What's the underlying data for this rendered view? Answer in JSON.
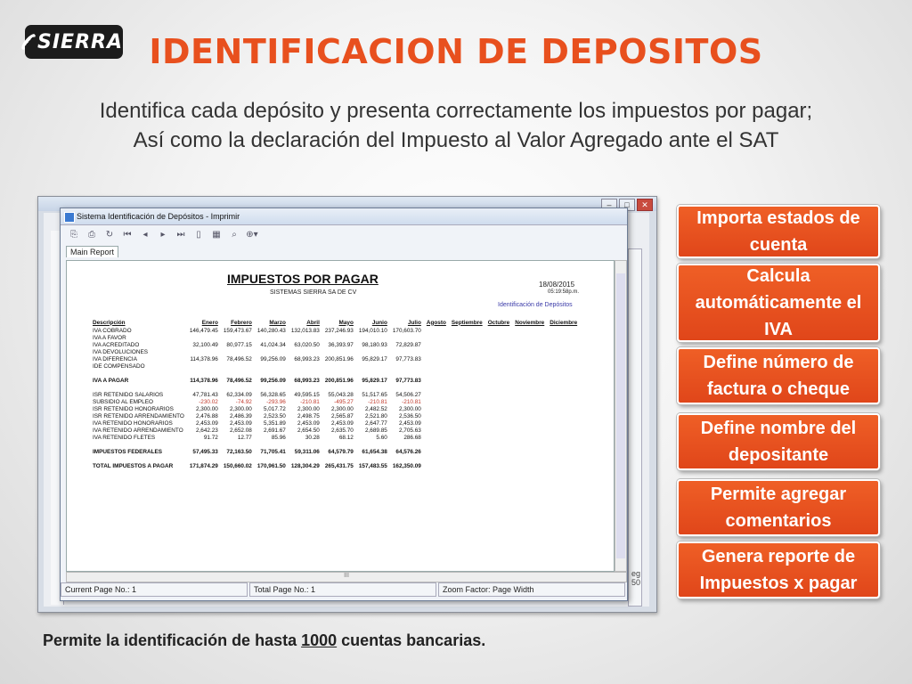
{
  "logo_text": "SIERRA",
  "title": "IDENTIFICACION DE DEPOSITOS",
  "subtitle_line1": "Identifica cada depósito y presenta correctamente los impuestos por pagar;",
  "subtitle_line2": "Así como la declaración del Impuesto al Valor Agregado ante el SAT",
  "features": [
    "Importa estados de cuenta",
    "Calcula automáticamente el IVA",
    "Define número de factura o cheque",
    "Define nombre del depositante",
    "Permite agregar comentarios",
    "Genera reporte de Impuestos x pagar"
  ],
  "footnote": {
    "before": "Permite la identificación de hasta ",
    "number": "1000",
    "after": " cuentas bancarias."
  },
  "window": {
    "title": "Sistema Identificación de Depósitos - Imprimir",
    "tab": "Main Report",
    "status_current": "Current Page No.: 1",
    "status_total": "Total Page No.: 1",
    "status_zoom": "Zoom Factor: Page Width",
    "bg_bottom_1": "eg",
    "bg_bottom_2": "50"
  },
  "report": {
    "title": "IMPUESTOS POR PAGAR",
    "company": "SISTEMAS SIERRA SA DE CV",
    "date": "18/08/2015",
    "time": "05:19:58p.m.",
    "link": "Identificación de Depósitos",
    "columns": [
      "Descripción",
      "Enero",
      "Febrero",
      "Marzo",
      "Abril",
      "Mayo",
      "Junio",
      "Julio",
      "Agosto",
      "Septiembre",
      "Octubre",
      "Noviembre",
      "Diciembre"
    ],
    "rows": [
      {
        "type": "row",
        "cells": [
          "IVA COBRADO",
          "146,479.45",
          "159,473.67",
          "140,280.43",
          "132,013.83",
          "237,246.93",
          "194,010.10",
          "170,603.70",
          "",
          "",
          "",
          "",
          ""
        ]
      },
      {
        "type": "row",
        "cells": [
          "IVA A FAVOR",
          "",
          "",
          "",
          "",
          "",
          "",
          "",
          "",
          "",
          "",
          "",
          ""
        ]
      },
      {
        "type": "row",
        "cells": [
          "IVA ACREDITADO",
          "32,100.49",
          "80,977.15",
          "41,024.34",
          "63,020.50",
          "36,393.97",
          "98,180.93",
          "72,829.87",
          "",
          "",
          "",
          "",
          ""
        ]
      },
      {
        "type": "row",
        "cells": [
          "IVA DEVOLUCIONES",
          "",
          "",
          "",
          "",
          "",
          "",
          "",
          "",
          "",
          "",
          "",
          ""
        ]
      },
      {
        "type": "row",
        "cells": [
          "IVA DIFERENCIA",
          "114,378.96",
          "78,496.52",
          "99,256.09",
          "68,993.23",
          "200,851.96",
          "95,829.17",
          "97,773.83",
          "",
          "",
          "",
          "",
          ""
        ]
      },
      {
        "type": "row",
        "cells": [
          "IDE COMPENSADO",
          "",
          "",
          "",
          "",
          "",
          "",
          "",
          "",
          "",
          "",
          "",
          ""
        ]
      },
      {
        "type": "gap",
        "cells": [
          "",
          "",
          "",
          "",
          "",
          "",
          "",
          "",
          "",
          "",
          "",
          "",
          ""
        ]
      },
      {
        "type": "bold",
        "cells": [
          "IVA A PAGAR",
          "114,378.96",
          "78,496.52",
          "99,256.09",
          "68,993.23",
          "200,851.96",
          "95,829.17",
          "97,773.83",
          "",
          "",
          "",
          "",
          ""
        ]
      },
      {
        "type": "gap",
        "cells": [
          "",
          "",
          "",
          "",
          "",
          "",
          "",
          "",
          "",
          "",
          "",
          "",
          ""
        ]
      },
      {
        "type": "row",
        "cells": [
          "ISR RETENIDO SALARIOS",
          "47,781.43",
          "62,334.09",
          "56,328.65",
          "49,595.15",
          "55,043.28",
          "51,517.65",
          "54,506.27",
          "",
          "",
          "",
          "",
          ""
        ]
      },
      {
        "type": "neg",
        "cells": [
          "SUBSIDIO AL EMPLEO",
          "-230.02",
          "-74.92",
          "-293.96",
          "-210.81",
          "-495.27",
          "-210.81",
          "-210.81",
          "",
          "",
          "",
          "",
          ""
        ]
      },
      {
        "type": "row",
        "cells": [
          "ISR RETENIDO HONORARIOS",
          "2,300.00",
          "2,300.00",
          "5,017.72",
          "2,300.00",
          "2,300.00",
          "2,482.52",
          "2,300.00",
          "",
          "",
          "",
          "",
          ""
        ]
      },
      {
        "type": "row",
        "cells": [
          "ISR RETENIDO ARRENDAMIENTO",
          "2,476.88",
          "2,486.39",
          "2,523.50",
          "2,498.75",
          "2,565.87",
          "2,521.80",
          "2,536.50",
          "",
          "",
          "",
          "",
          ""
        ]
      },
      {
        "type": "row",
        "cells": [
          "IVA RETENIDO HONORARIOS",
          "2,453.09",
          "2,453.09",
          "5,351.89",
          "2,453.09",
          "2,453.09",
          "2,647.77",
          "2,453.09",
          "",
          "",
          "",
          "",
          ""
        ]
      },
      {
        "type": "row",
        "cells": [
          "IVA RETENIDO ARRENDAMIENTO",
          "2,642.23",
          "2,652.08",
          "2,691.67",
          "2,654.50",
          "2,635.70",
          "2,689.85",
          "2,705.63",
          "",
          "",
          "",
          "",
          ""
        ]
      },
      {
        "type": "row",
        "cells": [
          "IVA RETENIDO FLETES",
          "91.72",
          "12.77",
          "85.96",
          "30.28",
          "68.12",
          "5.60",
          "286.68",
          "",
          "",
          "",
          "",
          ""
        ]
      },
      {
        "type": "gap",
        "cells": [
          "",
          "",
          "",
          "",
          "",
          "",
          "",
          "",
          "",
          "",
          "",
          "",
          ""
        ]
      },
      {
        "type": "bold",
        "cells": [
          "IMPUESTOS FEDERALES",
          "57,495.33",
          "72,163.50",
          "71,705.41",
          "59,311.06",
          "64,579.79",
          "61,654.38",
          "64,576.26",
          "",
          "",
          "",
          "",
          ""
        ]
      },
      {
        "type": "gap",
        "cells": [
          "",
          "",
          "",
          "",
          "",
          "",
          "",
          "",
          "",
          "",
          "",
          "",
          ""
        ]
      },
      {
        "type": "bold",
        "cells": [
          "TOTAL IMPUESTOS A PAGAR",
          "171,874.29",
          "150,660.02",
          "170,961.50",
          "128,304.29",
          "265,431.75",
          "157,483.55",
          "162,350.09",
          "",
          "",
          "",
          "",
          ""
        ]
      }
    ]
  }
}
